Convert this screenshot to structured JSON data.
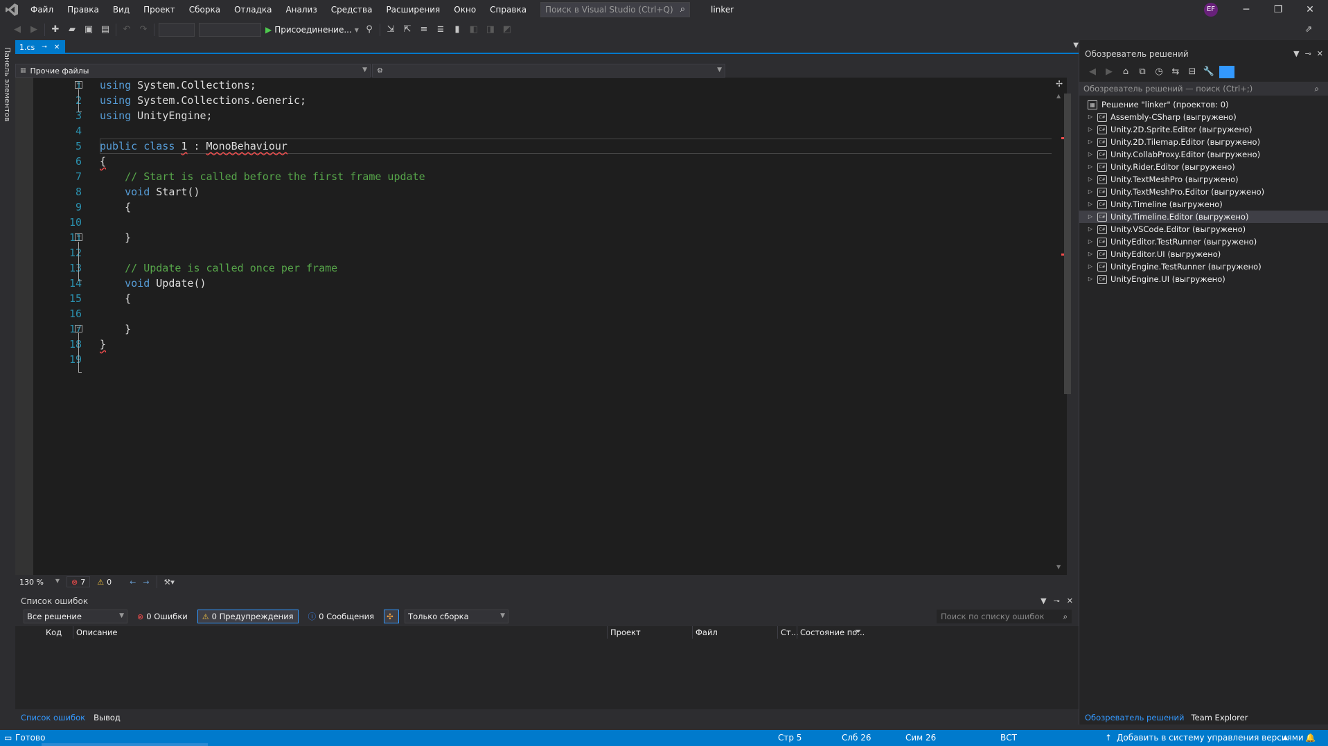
{
  "app": {
    "menu": [
      "Файл",
      "Правка",
      "Вид",
      "Проект",
      "Сборка",
      "Отладка",
      "Анализ",
      "Средства",
      "Расширения",
      "Окно",
      "Справка"
    ],
    "search_placeholder": "Поиск в Visual Studio (Ctrl+Q)",
    "solution_name": "linker",
    "account_initials": "EF"
  },
  "toolbar": {
    "attach_label": "Присоединение..."
  },
  "left_strip": {
    "toolbox_label": "Панель элементов"
  },
  "document": {
    "tab_label": "1.cs",
    "nav_project": "Прочие файлы"
  },
  "editor": {
    "line_numbers": [
      "1",
      "2",
      "3",
      "4",
      "5",
      "6",
      "7",
      "8",
      "9",
      "10",
      "11",
      "12",
      "13",
      "14",
      "15",
      "16",
      "17",
      "18",
      "19"
    ],
    "lines": [
      [
        {
          "t": "using",
          "c": "kw"
        },
        {
          "t": " System.Collections;",
          "c": ""
        }
      ],
      [
        {
          "t": "using",
          "c": "kw"
        },
        {
          "t": " System.Collections.Generic;",
          "c": ""
        }
      ],
      [
        {
          "t": "using",
          "c": "kw"
        },
        {
          "t": " UnityEngine;",
          "c": ""
        }
      ],
      [],
      [
        {
          "t": "public",
          "c": "kw"
        },
        {
          "t": " ",
          "c": ""
        },
        {
          "t": "class",
          "c": "kw"
        },
        {
          "t": " ",
          "c": ""
        },
        {
          "t": "1",
          "c": "sq"
        },
        {
          "t": " : ",
          "c": ""
        },
        {
          "t": "MonoBehaviour",
          "c": "sq"
        }
      ],
      [
        {
          "t": "{",
          "c": "sq"
        }
      ],
      [
        {
          "t": "    // Start is called before the first frame update",
          "c": "cm"
        }
      ],
      [
        {
          "t": "    ",
          "c": ""
        },
        {
          "t": "void",
          "c": "kw"
        },
        {
          "t": " Start()",
          "c": ""
        }
      ],
      [
        {
          "t": "    {",
          "c": ""
        }
      ],
      [],
      [
        {
          "t": "    }",
          "c": ""
        }
      ],
      [],
      [
        {
          "t": "    // Update is called once per frame",
          "c": "cm"
        }
      ],
      [
        {
          "t": "    ",
          "c": ""
        },
        {
          "t": "void",
          "c": "kw"
        },
        {
          "t": " Update()",
          "c": ""
        }
      ],
      [
        {
          "t": "    {",
          "c": ""
        }
      ],
      [],
      [
        {
          "t": "    }",
          "c": ""
        }
      ],
      [
        {
          "t": "}",
          "c": "sq"
        }
      ],
      []
    ],
    "zoom": "130 %",
    "error_count": "7",
    "warning_count": "0"
  },
  "error_list": {
    "title": "Список ошибок",
    "scope": "Все решение",
    "errors_label": "0 Ошибки",
    "warnings_label": "0 Предупреждения",
    "messages_label": "0 Сообщения",
    "build_filter": "Только сборка",
    "search_placeholder": "Поиск по списку ошибок",
    "columns": {
      "code": "Код",
      "description": "Описание",
      "project": "Проект",
      "file": "Файл",
      "line": "Ст...",
      "suppression": "Состояние по..."
    },
    "bottom_tabs": [
      "Список ошибок",
      "Вывод"
    ]
  },
  "solution_explorer": {
    "title": "Обозреватель решений",
    "search_placeholder": "Обозреватель решений — поиск (Ctrl+;)",
    "solution_label": "Решение \"linker\"  (проектов: 0)",
    "projects": [
      "Assembly-CSharp (выгружено)",
      "Unity.2D.Sprite.Editor (выгружено)",
      "Unity.2D.Tilemap.Editor (выгружено)",
      "Unity.CollabProxy.Editor (выгружено)",
      "Unity.Rider.Editor (выгружено)",
      "Unity.TextMeshPro (выгружено)",
      "Unity.TextMeshPro.Editor (выгружено)",
      "Unity.Timeline (выгружено)",
      "Unity.Timeline.Editor (выгружено)",
      "Unity.VSCode.Editor (выгружено)",
      "UnityEditor.TestRunner (выгружено)",
      "UnityEditor.UI (выгружено)",
      "UnityEngine.TestRunner (выгружено)",
      "UnityEngine.UI (выгружено)"
    ],
    "selected_project": "Unity.Timeline.Editor (выгружено)",
    "bottom_tabs": [
      "Обозреватель решений",
      "Team Explorer"
    ]
  },
  "statusbar": {
    "state": "Готово",
    "line": "Стр 5",
    "col": "Слб 26",
    "char": "Сим 26",
    "mode": "ВСТ",
    "source_control": "Добавить в систему управления версиями"
  },
  "colors": {
    "accent": "#007acc",
    "keyword": "#569cd6",
    "comment": "#57a64a",
    "line_number": "#2b91af",
    "error": "#f14c4c"
  }
}
